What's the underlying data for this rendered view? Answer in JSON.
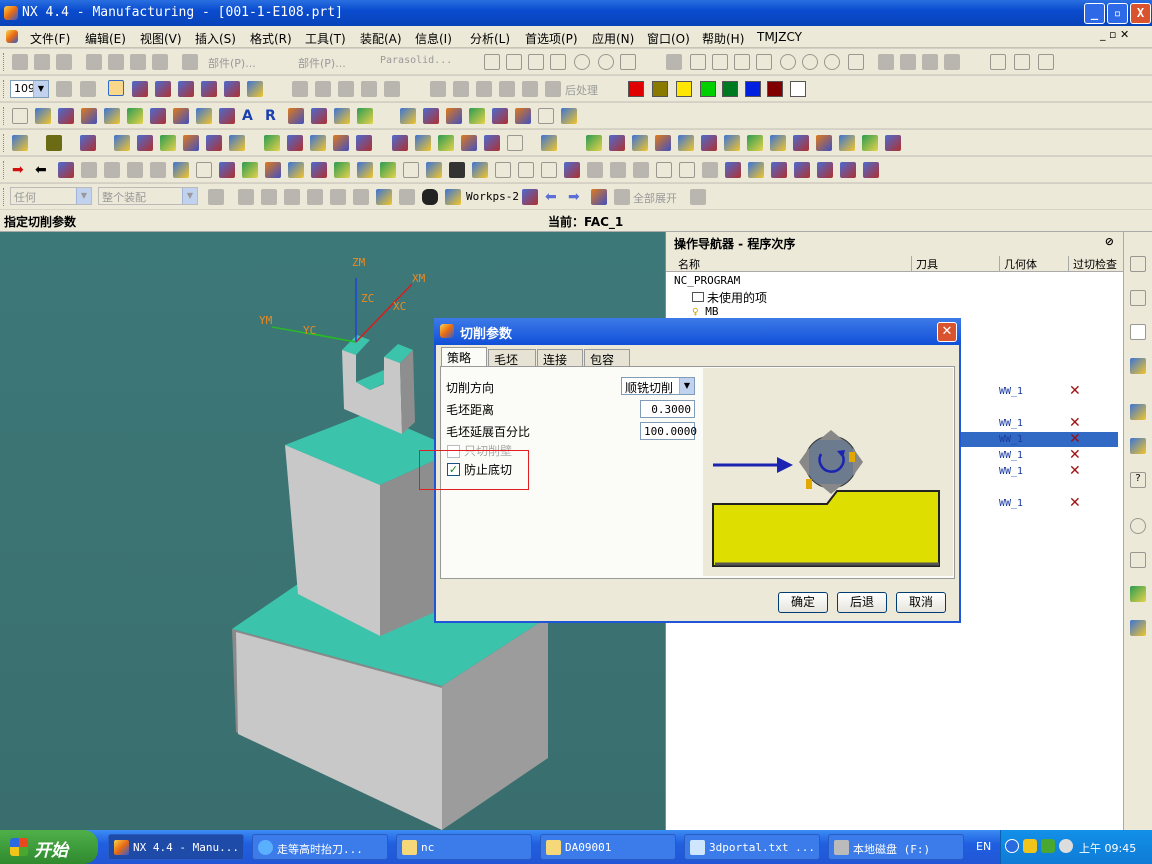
{
  "window": {
    "title": "NX 4.4 - Manufacturing - [001-1-E108.prt]",
    "min": "_",
    "max": "▫",
    "close": "X"
  },
  "menu": [
    "文件(F)",
    "编辑(E)",
    "视图(V)",
    "插入(S)",
    "格式(R)",
    "工具(T)",
    "装配(A)",
    "信息(I)",
    "分析(L)",
    "首选项(P)",
    "应用(N)",
    "窗口(O)",
    "帮助(H)",
    "TMJZCY"
  ],
  "toolbar1": {
    "part_label": "部件(P)...",
    "part_label2": "部件(P)...",
    "parasolid": "Parasolid..."
  },
  "toolbar2": {
    "zoom_value": "109",
    "postprocess": "后处理"
  },
  "colors": [
    "#e00000",
    "#8a7a00",
    "#ffe600",
    "#00d000",
    "#007a20",
    "#0020e0",
    "#800000",
    "#ffffff"
  ],
  "toolbar6": {
    "filter": "任何",
    "assembly": "整个装配",
    "workpiece": "Workps-2",
    "expand_all": "全部展开"
  },
  "status": {
    "prompt": "指定切削参数",
    "current": "当前：FAC_1"
  },
  "axes": {
    "zm": "ZM",
    "xm": "XM",
    "ym": "YM",
    "zc": "ZC",
    "xc": "XC",
    "yc": "YC"
  },
  "navigator": {
    "title": "操作导航器 - 程序次序",
    "columns": [
      "名称",
      "刀具",
      "几何体",
      "过切检查"
    ],
    "tree": [
      "NC_PROGRAM",
      "未使用的项",
      "MB"
    ],
    "rows": [
      {
        "geom": "WW_1"
      },
      {
        "geom": "WW_1"
      },
      {
        "geom": "WW_1"
      },
      {
        "geom": "WW_1"
      },
      {
        "geom": "WW_1"
      },
      {
        "geom": "WW_1"
      }
    ],
    "xmark": "✕"
  },
  "dialog": {
    "title": "切削参数",
    "tabs": [
      "策略",
      "毛坯",
      "连接",
      "包容"
    ],
    "cut_direction_label": "切削方向",
    "cut_direction_value": "顺铣切削",
    "blank_distance_label": "毛坯距离",
    "blank_distance_value": "0.3000",
    "blank_extend_label": "毛坯延展百分比",
    "blank_extend_value": "100.0000",
    "cut_walls_only_label": "只切削壁",
    "prevent_undercut_label": "防止底切",
    "ok": "确定",
    "back": "后退",
    "cancel": "取消"
  },
  "taskbar": {
    "start": "开始",
    "tasks": [
      "NX 4.4 - Manu...",
      "走等高时抬刀...",
      "nc",
      "DA09001",
      "3dportal.txt ...",
      "本地磁盘 (F:)"
    ],
    "lang": "EN",
    "clock": "上午 09:45"
  }
}
